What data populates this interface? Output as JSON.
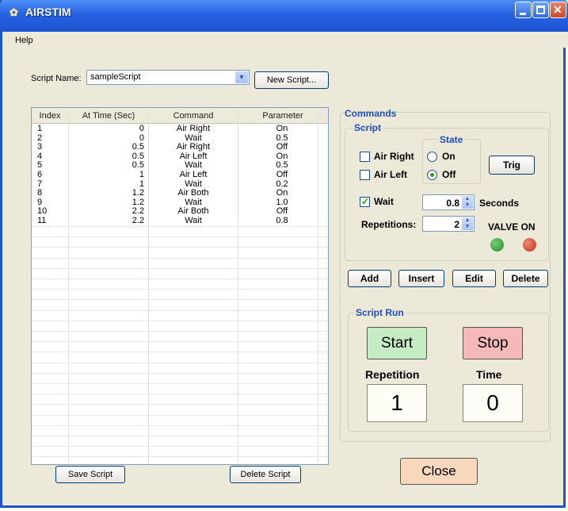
{
  "window": {
    "title": "AIRSTIM"
  },
  "menu": {
    "help": "Help"
  },
  "script_name": {
    "label": "Script Name:",
    "value": "sampleScript",
    "new_button": "New Script..."
  },
  "table": {
    "headers": [
      "Index",
      "At Time (Sec)",
      "Command",
      "Parameter"
    ],
    "rows": [
      [
        "1",
        "0",
        "Air Right",
        "On"
      ],
      [
        "2",
        "0",
        "Wait",
        "0.5"
      ],
      [
        "3",
        "0.5",
        "Air Right",
        "Off"
      ],
      [
        "4",
        "0.5",
        "Air Left",
        "On"
      ],
      [
        "5",
        "0.5",
        "Wait",
        "0.5"
      ],
      [
        "6",
        "1",
        "Air Left",
        "Off"
      ],
      [
        "7",
        "1",
        "Wait",
        "0.2"
      ],
      [
        "8",
        "1.2",
        "Air Both",
        "On"
      ],
      [
        "9",
        "1.2",
        "Wait",
        "1.0"
      ],
      [
        "10",
        "2.2",
        "Air Both",
        "Off"
      ],
      [
        "11",
        "2.2",
        "Wait",
        "0.8"
      ]
    ]
  },
  "commands": {
    "title": "Commands",
    "script_title": "Script",
    "air_right": "Air Right",
    "air_left": "Air Left",
    "state_title": "State",
    "state_on": "On",
    "state_off": "Off",
    "trig": "Trig",
    "wait": "Wait",
    "wait_value": "0.8",
    "seconds": "Seconds",
    "repetitions_label": "Repetitions:",
    "repetitions_value": "2",
    "valve_on": "VALVE ON",
    "led_colors": {
      "green": "#2f8a2f",
      "red": "#b8331c"
    },
    "add": "Add",
    "insert": "Insert",
    "edit": "Edit",
    "delete": "Delete"
  },
  "script_run": {
    "title": "Script Run",
    "start": "Start",
    "stop": "Stop",
    "repetition_label": "Repetition",
    "repetition_value": "1",
    "time_label": "Time",
    "time_value": "0",
    "start_color": "#c5ecc2",
    "stop_color": "#f5b9b9"
  },
  "footer": {
    "save": "Save Script",
    "delete": "Delete Script",
    "close": "Close",
    "close_color": "#f8d8bc"
  }
}
